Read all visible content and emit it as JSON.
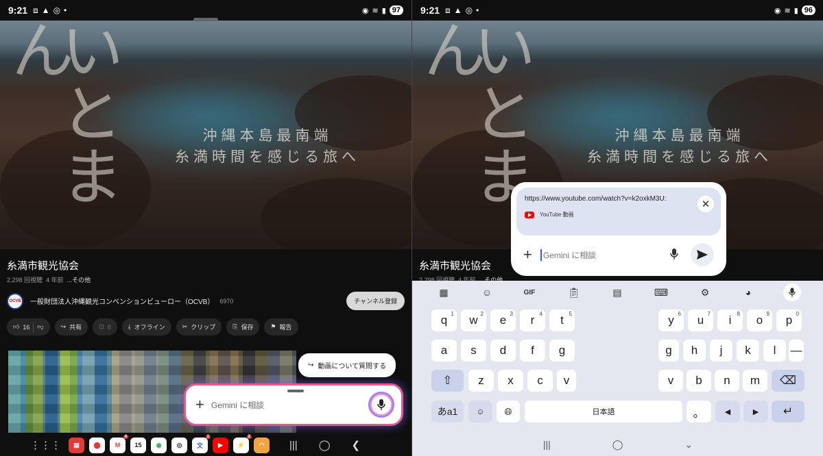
{
  "left": {
    "status": {
      "time": "9:21",
      "battery": "97"
    },
    "video": {
      "vertical_text": "いとまん",
      "caption_line1": "沖縄本島最南端",
      "caption_line2": "糸満時間を感じる旅へ"
    },
    "channel_title": "糸満市観光協会",
    "meta": {
      "views": "2,298 回視聴",
      "age": "4 年前",
      "more": "...その他"
    },
    "org": {
      "name": "一般財団法人沖縄観光コンベンションビューロー（OCVB）",
      "subs": "6970",
      "logo_text": "OCVB",
      "subscribe": "チャンネル登録"
    },
    "actions": {
      "likes": "16",
      "share": "共有",
      "remix_count": "0",
      "offline": "オフライン",
      "clip": "クリップ",
      "save": "保存",
      "report": "報告"
    },
    "ask_bubble": "動画について質問する",
    "gemini_placeholder": "Gemini に相談",
    "dock": {
      "calendar_day": "15",
      "badge_gmail": "4",
      "badge_translate": "1",
      "badge_messenger": "2"
    }
  },
  "right": {
    "status": {
      "time": "9:21",
      "battery": "96"
    },
    "popup": {
      "url": "https://www.youtube.com/watch?v=k2oxkM3U:",
      "source": "YouTube 動画",
      "placeholder": "Gemini に相談"
    },
    "keyboard": {
      "toolbar": [
        "apps-icon",
        "sticker-icon",
        "GIF",
        "clipboard-icon",
        "keypad-icon",
        "keyboard-icon",
        "settings-icon",
        "palette-icon",
        "mic-icon"
      ],
      "row1_left": [
        {
          "k": "q",
          "s": "1"
        },
        {
          "k": "w",
          "s": "2"
        },
        {
          "k": "e",
          "s": "3"
        },
        {
          "k": "r",
          "s": "4"
        },
        {
          "k": "t",
          "s": "5"
        }
      ],
      "row1_right": [
        {
          "k": "y",
          "s": "6"
        },
        {
          "k": "u",
          "s": "7"
        },
        {
          "k": "i",
          "s": "8"
        },
        {
          "k": "o",
          "s": "9"
        },
        {
          "k": "p",
          "s": "0"
        }
      ],
      "row2_left": [
        "a",
        "s",
        "d",
        "f",
        "g"
      ],
      "row2_right": [
        "g",
        "h",
        "j",
        "k",
        "l",
        "—"
      ],
      "row3_left": [
        "z",
        "x",
        "c",
        "v"
      ],
      "row3_right": [
        "v",
        "b",
        "n",
        "m"
      ],
      "lang_key": "あa1",
      "space_label": "日本語",
      "period": "。"
    }
  }
}
